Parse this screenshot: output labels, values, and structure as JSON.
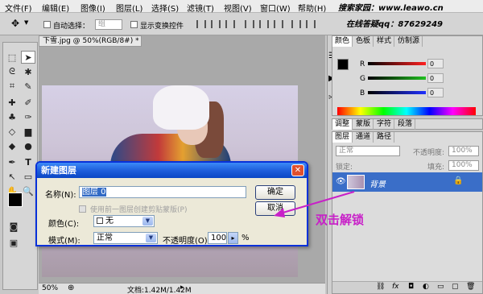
{
  "menubar": {
    "items": [
      "文件(F)",
      "编辑(E)",
      "图像(I)",
      "图层(L)",
      "选择(S)",
      "滤镜(T)",
      "视图(V)",
      "窗口(W)",
      "帮助(H)"
    ],
    "site": "搜索家园：www.leawo.cn",
    "qq": "在线答疑qq：87629249"
  },
  "options": {
    "auto_select": "自动选择：",
    "auto_select_value": "组",
    "show_transform": "显示变换控件"
  },
  "document": {
    "tab_title": "下雪.jpg @ 50%(RGB/8#) *",
    "zoom": "50%",
    "doc_info": "文档:1.42M/1.42M"
  },
  "color_panel": {
    "tabs": [
      "颜色",
      "色板",
      "样式",
      "仿制源"
    ],
    "channels": [
      {
        "label": "R",
        "value": "0",
        "color": "#ff2020"
      },
      {
        "label": "G",
        "value": "0",
        "color": "#20c020"
      },
      {
        "label": "B",
        "value": "0",
        "color": "#2030ff"
      }
    ]
  },
  "adjust_tabs": [
    "调整",
    "蒙版",
    "字符",
    "段落"
  ],
  "layers_panel": {
    "tabs": [
      "图层",
      "通道",
      "路径"
    ],
    "blend_mode": "正常",
    "opacity_label": "不透明度:",
    "opacity_value": "100%",
    "lock_label": "锁定:",
    "fill_label": "填充:",
    "fill_value": "100%",
    "layer_name": "背景"
  },
  "dialog": {
    "title": "新建图层",
    "name_label": "名称(N):",
    "name_value": "图层 0",
    "clip_label": "使用前一图层创建剪贴蒙版(P)",
    "color_label": "颜色(C):",
    "color_value": "无",
    "mode_label": "模式(M):",
    "mode_value": "正常",
    "opacity_label": "不透明度(O):",
    "opacity_value": "100",
    "opacity_unit": "%",
    "ok": "确定",
    "cancel": "取消"
  },
  "annotation": "双击解锁",
  "colors": {
    "dialog_title": "#1f5fdc",
    "layer_selected": "#3a6ec8",
    "annotation": "#c820c8"
  }
}
